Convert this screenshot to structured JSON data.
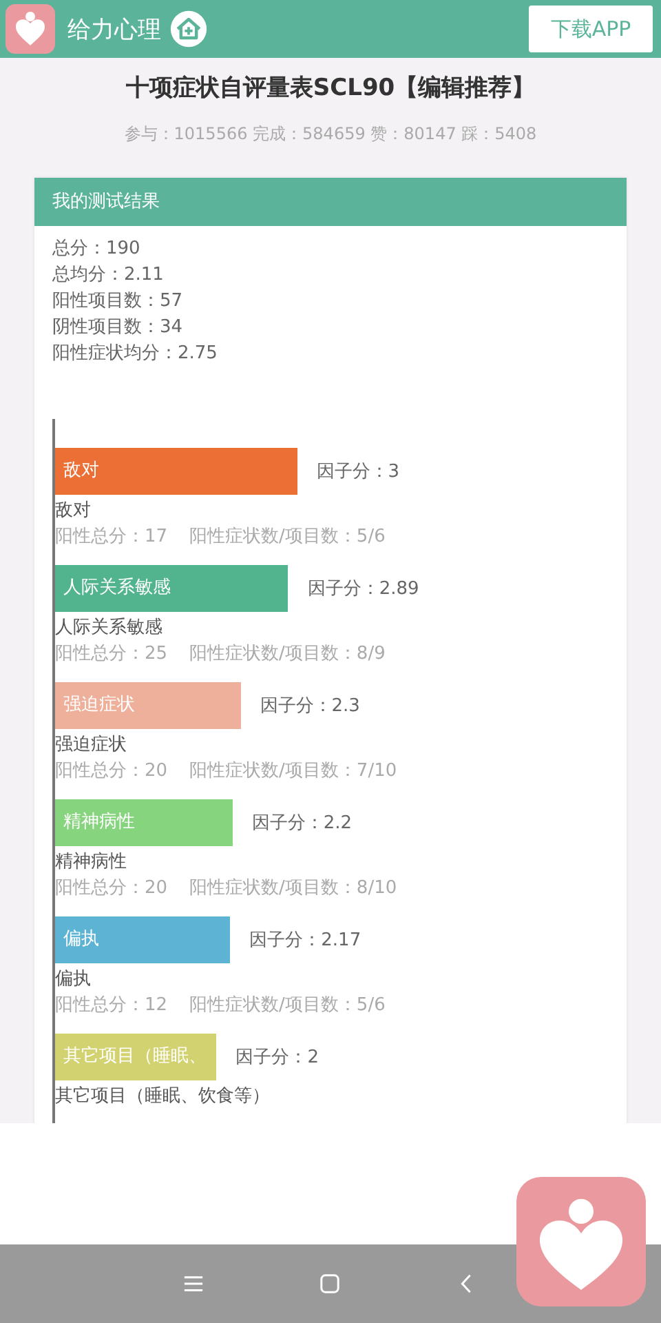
{
  "app_bar": {
    "brand": "给力心理",
    "download_button": "下载APP"
  },
  "title": "十项症状自评量表SCL90【编辑推荐】",
  "stats": "参与：1015566 完成：584659 赞：80147 踩：5408",
  "result_card": {
    "header": "我的测试结果",
    "summary": [
      "总分：190",
      "总均分：2.11",
      "阳性项目数：57",
      "阴性项目数：34",
      "阳性症状均分：2.75"
    ],
    "factors": [
      {
        "bar_label": "敌对",
        "color": "#ec7035",
        "score": "因子分：3",
        "name": "敌对",
        "positive_total": "阳性总分：17",
        "ratio": "阳性症状数/项目数：5/6"
      },
      {
        "bar_label": "人际关系敏感",
        "color": "#52b48e",
        "score": "因子分：2.89",
        "name": "人际关系敏感",
        "positive_total": "阳性总分：25",
        "ratio": "阳性症状数/项目数：8/9"
      },
      {
        "bar_label": "强迫症状",
        "color": "#eeb09a",
        "score": "因子分：2.3",
        "name": "强迫症状",
        "positive_total": "阳性总分：20",
        "ratio": "阳性症状数/项目数：7/10"
      },
      {
        "bar_label": "精神病性",
        "color": "#86d47d",
        "score": "因子分：2.2",
        "name": "精神病性",
        "positive_total": "阳性总分：20",
        "ratio": "阳性症状数/项目数：8/10"
      },
      {
        "bar_label": "偏执",
        "color": "#5db3d4",
        "score": "因子分：2.17",
        "name": "偏执",
        "positive_total": "阳性总分：12",
        "ratio": "阳性症状数/项目数：5/6"
      },
      {
        "bar_label": "其它项目（睡眠、",
        "color": "#d3d270",
        "score": "因子分：2",
        "name": "其它项目（睡眠、饮食等）"
      }
    ]
  }
}
